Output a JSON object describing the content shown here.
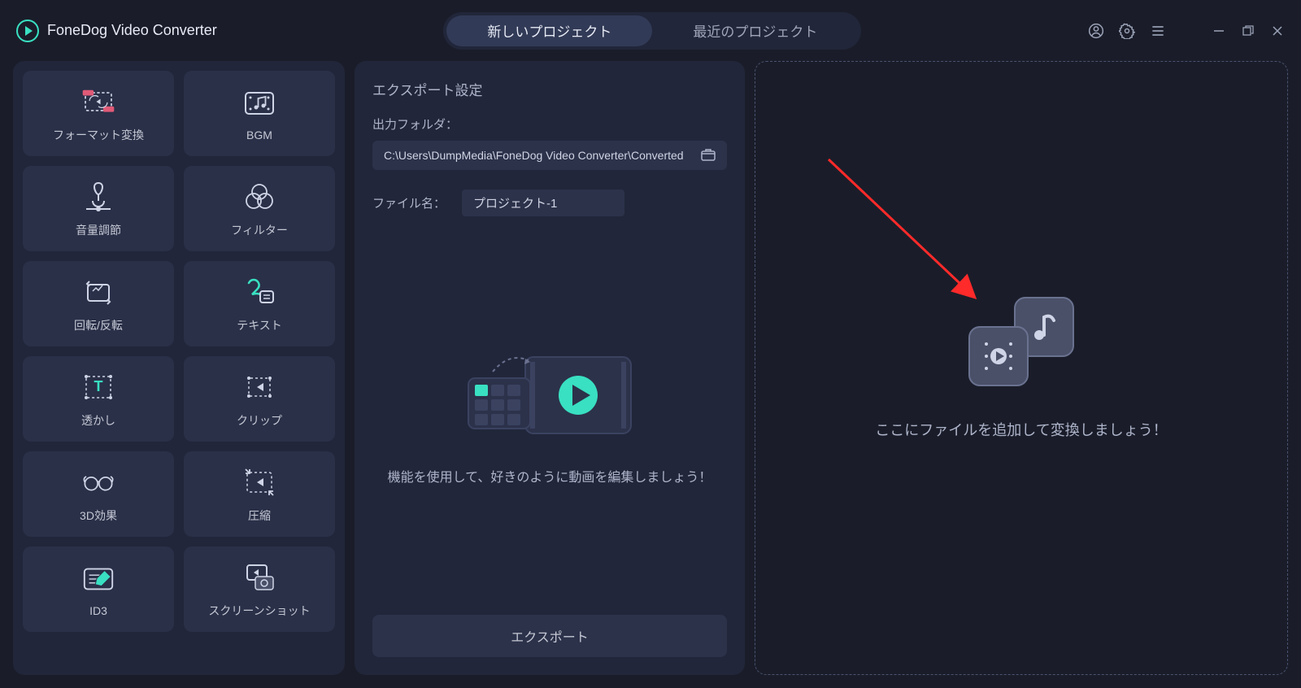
{
  "app": {
    "title": "FoneDog Video Converter"
  },
  "tabs": {
    "new_project": "新しいプロジェクト",
    "recent_project": "最近のプロジェクト"
  },
  "tools": [
    {
      "key": "format-convert",
      "label": "フォーマット変換"
    },
    {
      "key": "bgm",
      "label": "BGM"
    },
    {
      "key": "volume",
      "label": "音量調節"
    },
    {
      "key": "filter",
      "label": "フィルター"
    },
    {
      "key": "rotate",
      "label": "回転/反転"
    },
    {
      "key": "text",
      "label": "テキスト"
    },
    {
      "key": "watermark",
      "label": "透かし"
    },
    {
      "key": "clip",
      "label": "クリップ"
    },
    {
      "key": "effect-3d",
      "label": "3D効果"
    },
    {
      "key": "compress",
      "label": "圧縮"
    },
    {
      "key": "id3",
      "label": "ID3"
    },
    {
      "key": "screenshot",
      "label": "スクリーンショット"
    }
  ],
  "export": {
    "title": "エクスポート設定",
    "output_folder_label": "出力フォルダ：",
    "output_folder_path": "C:\\Users\\DumpMedia\\FoneDog Video Converter\\Converted",
    "file_name_label": "ファイル名：",
    "file_name_value": "プロジェクト-1",
    "illustration_text": "機能を使用して、好きのように動画を編集しましょう！",
    "export_button": "エクスポート"
  },
  "dropzone": {
    "text": "ここにファイルを追加して変換しましょう！"
  },
  "colors": {
    "accent": "#39e0c2"
  }
}
